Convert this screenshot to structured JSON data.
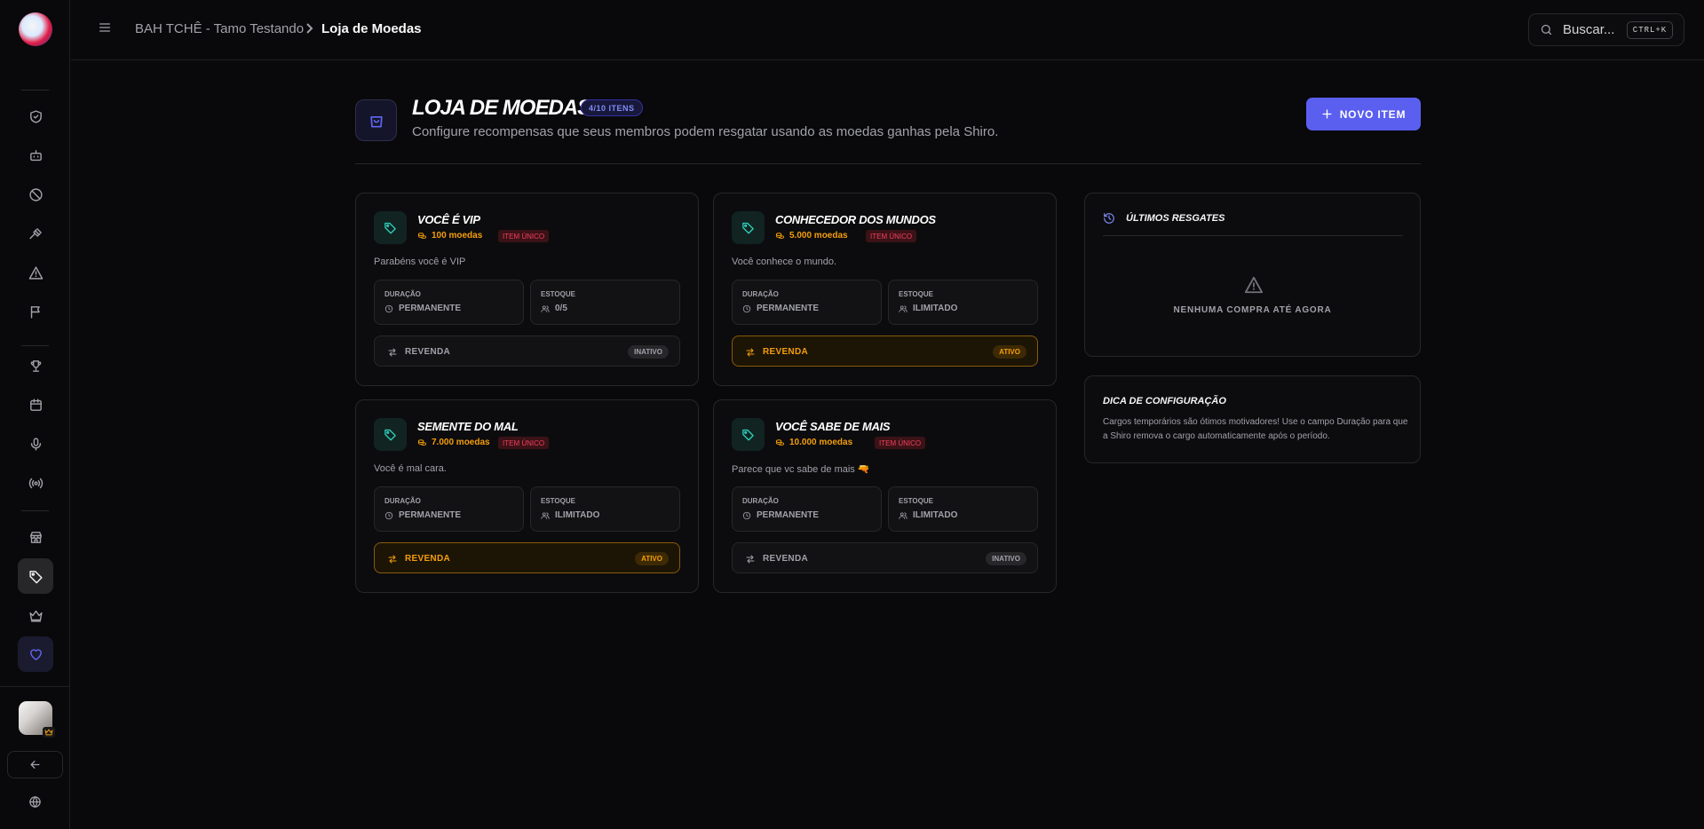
{
  "topbar": {
    "breadcrumb_server": "BAH TCHÊ - Tamo Testando",
    "breadcrumb_page": "Loja de Moedas",
    "search_placeholder": "Buscar...",
    "search_shortcut": "CTRL+K"
  },
  "header": {
    "title": "LOJA DE MOEDAS",
    "count_badge": "4/10 ITENS",
    "subtitle": "Configure recompensas que seus membros podem resgatar usando as moedas ganhas pela Shiro.",
    "new_item_label": "NOVO ITEM"
  },
  "labels": {
    "duration": "DURAÇÃO",
    "stock": "ESTOQUE",
    "resale": "REVENDA"
  },
  "items": [
    {
      "name": "VOCÊ É VIP",
      "price": "100 moedas",
      "badge": "ITEM ÚNICO",
      "description": "Parabéns você é VIP",
      "duration": "PERMANENTE",
      "stock": "0/5",
      "resale_status": "INATIVO",
      "resale_active": false
    },
    {
      "name": "CONHECEDOR DOS MUNDOS",
      "price": "5.000 moedas",
      "badge": "ITEM ÚNICO",
      "description": "Você conhece o mundo.",
      "duration": "PERMANENTE",
      "stock": "ILIMITADO",
      "resale_status": "ATIVO",
      "resale_active": true
    },
    {
      "name": "SEMENTE DO MAL",
      "price": "7.000 moedas",
      "badge": "ITEM ÚNICO",
      "description": "Você é mal cara.",
      "duration": "PERMANENTE",
      "stock": "ILIMITADO",
      "resale_status": "ATIVO",
      "resale_active": true
    },
    {
      "name": "VOCÊ SABE DE MAIS",
      "price": "10.000 moedas",
      "badge": "ITEM ÚNICO",
      "description": "Parece que vc sabe de mais 🔫",
      "duration": "PERMANENTE",
      "stock": "ILIMITADO",
      "resale_status": "INATIVO",
      "resale_active": false
    }
  ],
  "recent": {
    "title": "ÚLTIMOS RESGATES",
    "empty_text": "NENHUMA COMPRA ATÉ AGORA"
  },
  "tip": {
    "title": "DICA DE CONFIGURAÇÃO",
    "text": "Cargos temporários são ótimos motivadores! Use o campo Duração para que a Shiro remova o cargo automaticamente após o período."
  },
  "colors": {
    "accent": "#5b5ff0",
    "coin": "#f59e0b",
    "unique_badge": "#f43f5e",
    "tag_icon": "#2dd4bf"
  },
  "sidebar_icons": [
    "shield-icon",
    "bot-icon",
    "ban-icon",
    "gavel-icon",
    "warning-icon",
    "flag-icon",
    "trophy-icon",
    "calendar-icon",
    "microphone-icon",
    "broadcast-icon",
    "store-icon",
    "tag-icon",
    "crown-icon",
    "heart-icon"
  ]
}
